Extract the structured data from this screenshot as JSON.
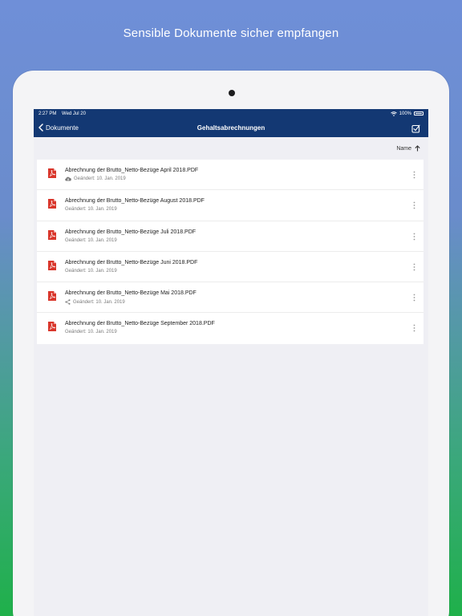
{
  "headline": "Sensible Dokumente sicher empfangen",
  "status_bar": {
    "time": "2:27 PM",
    "date": "Wed Jul 20",
    "battery": "100%"
  },
  "nav": {
    "back_label": "Dokumente",
    "title": "Gehaltsabrechnungen"
  },
  "sort": {
    "label": "Name"
  },
  "files": [
    {
      "name": "Abrechnung der Brutto_Netto-Bezüge April 2018.PDF",
      "meta": "Geändert: 10. Jan. 2019",
      "status_icon": "cloud-download-icon"
    },
    {
      "name": "Abrechnung der Brutto_Netto-Bezüge August 2018.PDF",
      "meta": "Geändert: 10. Jan. 2019",
      "status_icon": ""
    },
    {
      "name": "Abrechnung der Brutto_Netto-Bezüge Juli 2018.PDF",
      "meta": "Geändert: 10. Jan. 2019",
      "status_icon": ""
    },
    {
      "name": "Abrechnung der Brutto_Netto-Bezüge Juni 2018.PDF",
      "meta": "Geändert: 10. Jan. 2019",
      "status_icon": ""
    },
    {
      "name": "Abrechnung der Brutto_Netto-Bezüge Mai 2018.PDF",
      "meta": "Geändert: 10. Jan. 2019",
      "status_icon": "share-icon"
    },
    {
      "name": "Abrechnung der Brutto_Netto-Bezüge September 2018.PDF",
      "meta": "Geändert: 10. Jan. 2019",
      "status_icon": ""
    }
  ],
  "colors": {
    "nav_bg": "#133873",
    "pdf_red": "#d9362b",
    "accent_gradient_top": "#6f8fd8",
    "accent_gradient_bottom": "#1fb04a"
  }
}
